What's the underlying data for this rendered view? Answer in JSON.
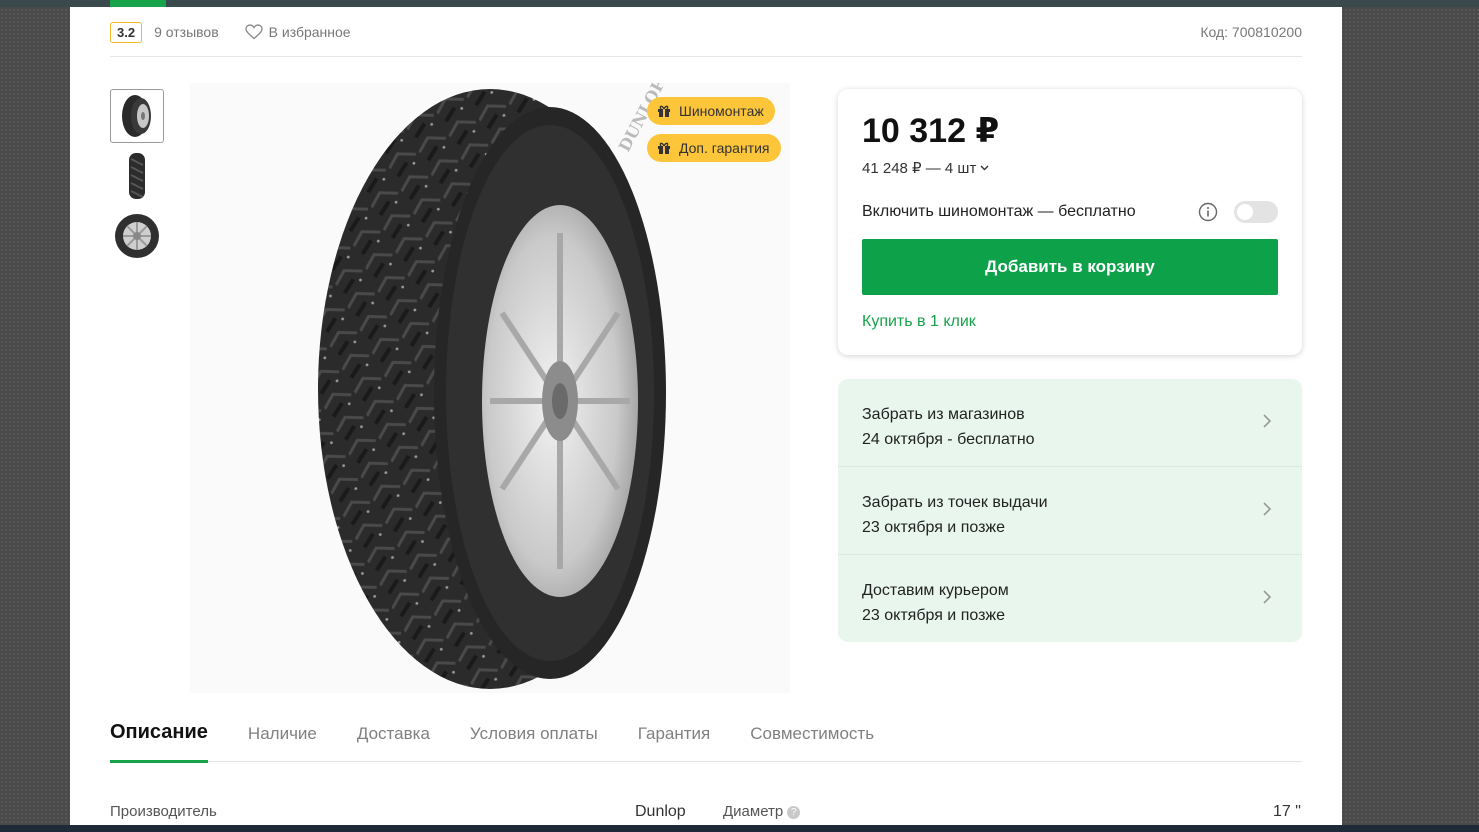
{
  "header": {
    "rating": "3.2",
    "reviews": "9 отзывов",
    "favorite_label": "В избранное",
    "code": "Код: 700810200"
  },
  "badges": [
    {
      "icon": "gift-icon",
      "label": "Шиномонтаж"
    },
    {
      "icon": "gift-icon",
      "label": "Доп. гарантия"
    }
  ],
  "product": {
    "brand_on_tire": "DUNLOP",
    "thumbnails": [
      "tire-angle",
      "tire-tread",
      "tire-side"
    ]
  },
  "price_card": {
    "price": "10 312 ₽",
    "total": "41 248 ₽ — 4 шт",
    "mount_label": "Включить шиномонтаж — бесплатно",
    "mount_enabled": false,
    "add_to_cart": "Добавить в корзину",
    "one_click": "Купить в 1 клик"
  },
  "delivery": [
    {
      "title": "Забрать из магазинов",
      "subtitle": "24 октября - бесплатно"
    },
    {
      "title": "Забрать из точек выдачи",
      "subtitle": "23 октября и позже"
    },
    {
      "title": "Доставим курьером",
      "subtitle": "23 октября и позже"
    }
  ],
  "tabs": [
    "Описание",
    "Наличие",
    "Доставка",
    "Условия оплаты",
    "Гарантия",
    "Совместимость"
  ],
  "specs": {
    "manufacturer_label": "Производитель",
    "manufacturer_value": "Dunlop",
    "diameter_label": "Диаметр",
    "diameter_help": "?",
    "diameter_value": "17 \""
  },
  "colors": {
    "accent": "#0da14a",
    "badge": "#fcc53a",
    "delivery_bg": "#e9f6ee"
  }
}
